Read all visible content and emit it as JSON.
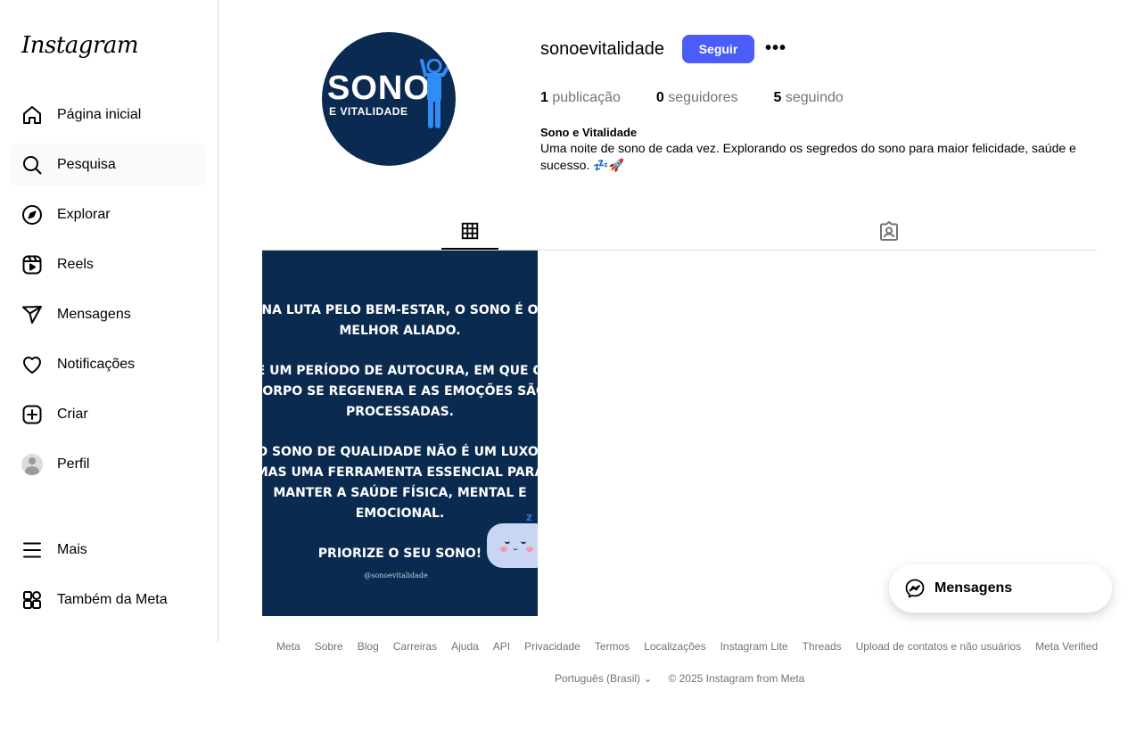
{
  "sidebar": {
    "logo": "Instagram",
    "items": [
      {
        "label": "Página inicial",
        "icon": "home-icon"
      },
      {
        "label": "Pesquisa",
        "icon": "search-icon"
      },
      {
        "label": "Explorar",
        "icon": "compass-icon"
      },
      {
        "label": "Reels",
        "icon": "reels-icon"
      },
      {
        "label": "Mensagens",
        "icon": "send-icon"
      },
      {
        "label": "Notificações",
        "icon": "heart-icon"
      },
      {
        "label": "Criar",
        "icon": "plus-square-icon"
      },
      {
        "label": "Perfil",
        "icon": "avatar"
      }
    ],
    "more": {
      "label": "Mais",
      "icon": "menu-icon"
    },
    "meta": {
      "label": "Também da Meta",
      "icon": "apps-icon"
    }
  },
  "profile": {
    "username": "sonoevitalidade",
    "follow_label": "Seguir",
    "more_label": "•••",
    "stats": {
      "posts_count": "1",
      "posts_label": "publicação",
      "followers_count": "0",
      "followers_label": "seguidores",
      "following_count": "5",
      "following_label": "seguindo"
    },
    "bio_name": "Sono e Vitalidade",
    "bio_text": "Uma noite de sono de cada vez. Explorando os segredos do sono para maior felicidade, saúde e sucesso. 💤🚀",
    "pic": {
      "title": "SONO",
      "subtitle": "E VITALIDADE"
    }
  },
  "tabs": [
    {
      "name": "posts",
      "icon": "grid-icon",
      "active": true
    },
    {
      "name": "tagged",
      "icon": "tagged-icon",
      "active": false
    }
  ],
  "post": {
    "paragraphs": [
      "NA LUTA PELO BEM-ESTAR, O SONO É O MELHOR ALIADO.",
      "É UM PERÍODO DE AUTOCURA, EM QUE O CORPO SE REGENERA E AS EMOÇÕES SÃO PROCESSADAS.",
      "O SONO DE QUALIDADE NÃO É UM LUXO, MAS UMA FERRAMENTA ESSENCIAL PARA MANTER A SAÚDE FÍSICA, MENTAL E EMOCIONAL.",
      "PRIORIZE O SEU SONO!"
    ],
    "handle": "@sonoevitalidade",
    "zz": "z z"
  },
  "footer": {
    "links": [
      "Meta",
      "Sobre",
      "Blog",
      "Carreiras",
      "Ajuda",
      "API",
      "Privacidade",
      "Termos",
      "Localizações",
      "Instagram Lite",
      "Threads",
      "Upload de contatos e não usuários",
      "Meta Verified"
    ],
    "language": "Português (Brasil)",
    "copyright": "© 2025 Instagram from Meta"
  },
  "messages_pill": {
    "label": "Mensagens"
  },
  "colors": {
    "accent": "#4a5df9",
    "post_bg": "#0b2a4f",
    "pic_bg": "#0b2a52"
  }
}
